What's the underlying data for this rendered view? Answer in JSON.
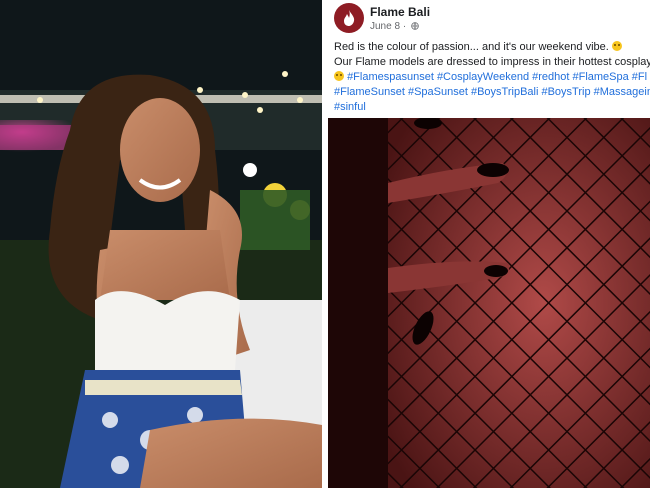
{
  "post": {
    "page_name": "Flame Bali",
    "date": "June 8",
    "dot": "·",
    "text_line1": "Red is the colour of passion... and it's our weekend vibe.",
    "text_line2": "Our Flame models are dressed to impress in their hottest cosplay",
    "hashtags_line1": "#Flamespasunset #CosplayWeekend #redhot #FlameSpa #Fl",
    "hashtags_line2": "#FlameSunset #SpaSunset #BoysTripBali #BoysTrip #Massagein",
    "hashtags_line3": "#sinful"
  },
  "icons": {
    "avatar": "flame-logo-icon",
    "privacy": "globe-icon",
    "emoji": "winking-face-icon"
  },
  "colors": {
    "hashtag": "#216fdb",
    "avatar_bg": "#8e1c24",
    "meta": "#65676b"
  }
}
